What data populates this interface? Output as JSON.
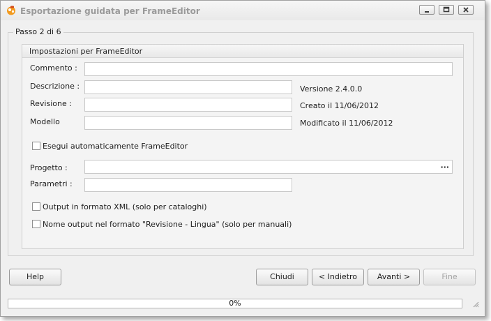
{
  "window": {
    "title": "Esportazione guidata per FrameEditor"
  },
  "step": {
    "label": "Passo 2 di 6"
  },
  "settings": {
    "group_title": "Impostazioni per FrameEditor",
    "commento": {
      "label": "Commento :",
      "value": ""
    },
    "descrizione": {
      "label": "Descrizione :",
      "value": ""
    },
    "revisione": {
      "label": "Revisione :",
      "value": ""
    },
    "modello": {
      "label": "Modello",
      "value": ""
    },
    "version_text": "Versione 2.4.0.0",
    "created_text": "Creato il 11/06/2012",
    "modified_text": "Modificato il 11/06/2012",
    "auto_run": {
      "label": "Esegui automaticamente FrameEditor",
      "checked": false
    },
    "progetto": {
      "label": "Progetto :",
      "value": "",
      "browse": "···"
    },
    "parametri": {
      "label": "Parametri :",
      "value": ""
    },
    "xml_output": {
      "label": "Output in formato XML (solo per cataloghi)",
      "checked": false
    },
    "name_output": {
      "label": "Nome output nel formato \"Revisione - Lingua\" (solo per manuali)",
      "checked": false
    }
  },
  "buttons": {
    "help": "Help",
    "close": "Chiudi",
    "back": "< Indietro",
    "next": "Avanti >",
    "finish": "Fine"
  },
  "progress": {
    "value": 0,
    "label": "0%"
  }
}
